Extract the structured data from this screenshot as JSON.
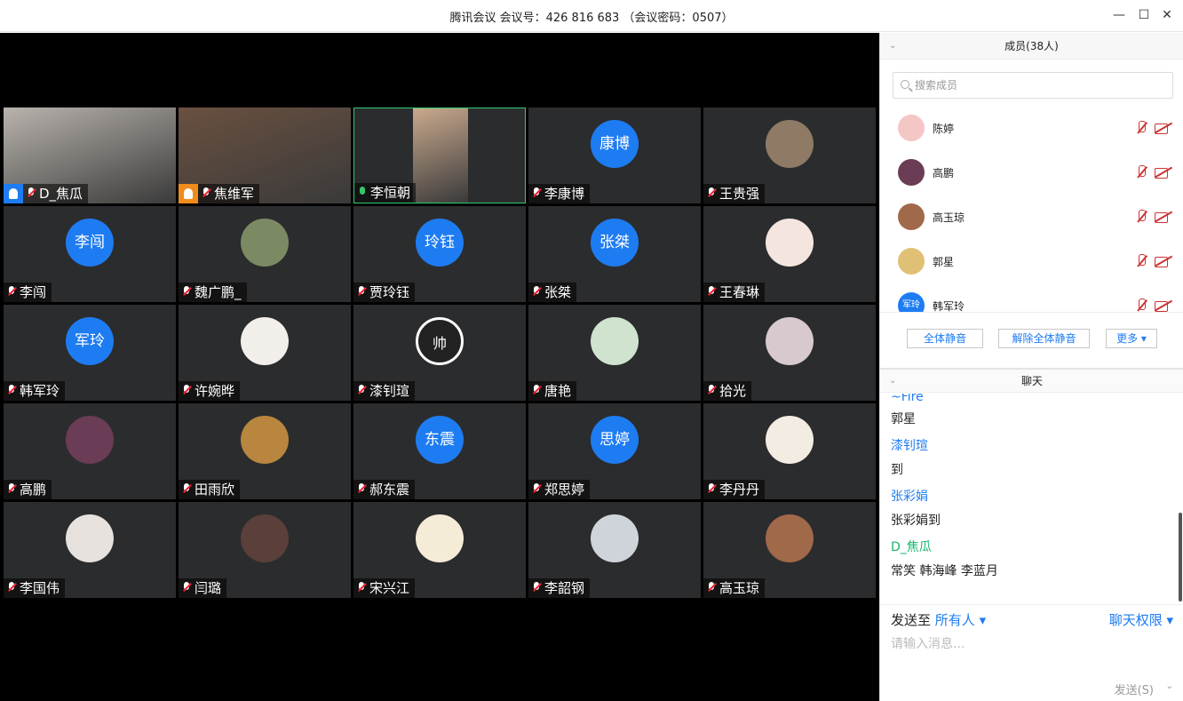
{
  "window": {
    "title": "腾讯会议  会议号：426 816 683 （会议密码：0507）",
    "minimize": "—",
    "maximize": "☐",
    "close": "✕"
  },
  "tiles": [
    {
      "name": "D_焦瓜",
      "avatar": "",
      "type": "video",
      "host": "blue",
      "mic": "muted",
      "color": "#b9b3ad"
    },
    {
      "name": "焦维军",
      "avatar": "",
      "type": "video",
      "host": "orange",
      "mic": "muted",
      "color": "#6a5040"
    },
    {
      "name": "李恒朝",
      "avatar": "",
      "type": "video",
      "host": "",
      "mic": "on",
      "color": "#c9a98d"
    },
    {
      "name": "李康博",
      "avatar": "康博",
      "type": "initials",
      "host": "",
      "mic": "muted",
      "color": "#1e7cf2"
    },
    {
      "name": "王贵强",
      "avatar": "",
      "type": "photo",
      "host": "",
      "mic": "muted",
      "color": "#8f7a66"
    },
    {
      "name": "李闯",
      "avatar": "李闯",
      "type": "initials",
      "host": "",
      "mic": "muted",
      "color": "#1e7cf2"
    },
    {
      "name": "魏广鹏_",
      "avatar": "",
      "type": "photo",
      "host": "",
      "mic": "muted",
      "color": "#7b8a63"
    },
    {
      "name": "贾玲钰",
      "avatar": "玲钰",
      "type": "initials",
      "host": "",
      "mic": "muted",
      "color": "#1e7cf2"
    },
    {
      "name": "张桀",
      "avatar": "张桀",
      "type": "initials",
      "host": "",
      "mic": "muted",
      "color": "#1e7cf2"
    },
    {
      "name": "王春琳",
      "avatar": "",
      "type": "photo",
      "host": "",
      "mic": "muted",
      "color": "#f4e6df"
    },
    {
      "name": "韩军玲",
      "avatar": "军玲",
      "type": "initials",
      "host": "",
      "mic": "muted",
      "color": "#1e7cf2"
    },
    {
      "name": "许婉晔",
      "avatar": "",
      "type": "photo",
      "host": "",
      "mic": "muted",
      "color": "#f2eeea"
    },
    {
      "name": "漆钊瑄",
      "avatar": "帅",
      "type": "photo",
      "host": "",
      "mic": "muted",
      "color": "#222222"
    },
    {
      "name": "唐艳",
      "avatar": "",
      "type": "photo",
      "host": "",
      "mic": "muted",
      "color": "#cfe3cf"
    },
    {
      "name": "拾光",
      "avatar": "",
      "type": "photo",
      "host": "",
      "mic": "muted",
      "color": "#d8c9cf"
    },
    {
      "name": "高鹏",
      "avatar": "",
      "type": "photo",
      "host": "",
      "mic": "muted",
      "color": "#6b3c55"
    },
    {
      "name": "田雨欣",
      "avatar": "",
      "type": "photo",
      "host": "",
      "mic": "muted",
      "color": "#b8863e"
    },
    {
      "name": "郝东震",
      "avatar": "东震",
      "type": "initials",
      "host": "",
      "mic": "muted",
      "color": "#1e7cf2"
    },
    {
      "name": "郑思婷",
      "avatar": "思婷",
      "type": "initials",
      "host": "",
      "mic": "muted",
      "color": "#1e7cf2"
    },
    {
      "name": " 李丹丹",
      "avatar": "",
      "type": "photo",
      "host": "",
      "mic": "muted",
      "color": "#f3ece2"
    },
    {
      "name": "李国伟",
      "avatar": "",
      "type": "photo",
      "host": "",
      "mic": "muted",
      "color": "#e7e2de"
    },
    {
      "name": "闫璐",
      "avatar": "",
      "type": "photo",
      "host": "",
      "mic": "muted",
      "color": "#5a3f3a"
    },
    {
      "name": "宋兴江",
      "avatar": "",
      "type": "photo",
      "host": "",
      "mic": "muted",
      "color": "#f5ecd8"
    },
    {
      "name": "李韶钢",
      "avatar": "",
      "type": "photo",
      "host": "",
      "mic": "muted",
      "color": "#cfd4da"
    },
    {
      "name": "高玉琼",
      "avatar": "",
      "type": "photo",
      "host": "",
      "mic": "muted",
      "color": "#a0694a"
    }
  ],
  "members_panel": {
    "title": "成员(38人)",
    "search_placeholder": "搜索成员",
    "members": [
      {
        "name": "陈婷",
        "avatar": "",
        "color": "#f5c6c6"
      },
      {
        "name": "高鹏",
        "avatar": "",
        "color": "#6b3c55"
      },
      {
        "name": "高玉琼",
        "avatar": "",
        "color": "#a0694a"
      },
      {
        "name": "郭星",
        "avatar": "",
        "color": "#e0c074"
      },
      {
        "name": "韩军玲",
        "avatar": "军玲",
        "color": "#1e7cf2"
      }
    ],
    "mute_all": "全体静音",
    "unmute_all": "解除全体静音",
    "more": "更多 ▾"
  },
  "chat_panel": {
    "title": "聊天",
    "messages": [
      {
        "text": "~Fire",
        "kind": "sender"
      },
      {
        "text": "郭星",
        "kind": "body"
      },
      {
        "text": "漆钊瑄",
        "kind": "sender"
      },
      {
        "text": "到",
        "kind": "body"
      },
      {
        "text": "张彩娟",
        "kind": "sender"
      },
      {
        "text": "张彩娟到",
        "kind": "body"
      },
      {
        "text": "D_焦瓜",
        "kind": "sender-host"
      },
      {
        "text": "常笑 韩海峰 李蓝月",
        "kind": "body"
      }
    ],
    "send_to_label": "发送至",
    "send_to_target": "所有人 ▾",
    "permission": "聊天权限 ▾",
    "input_placeholder": "请输入消息...",
    "send_button": "发送(S)",
    "send_dropdown": "⌄"
  }
}
